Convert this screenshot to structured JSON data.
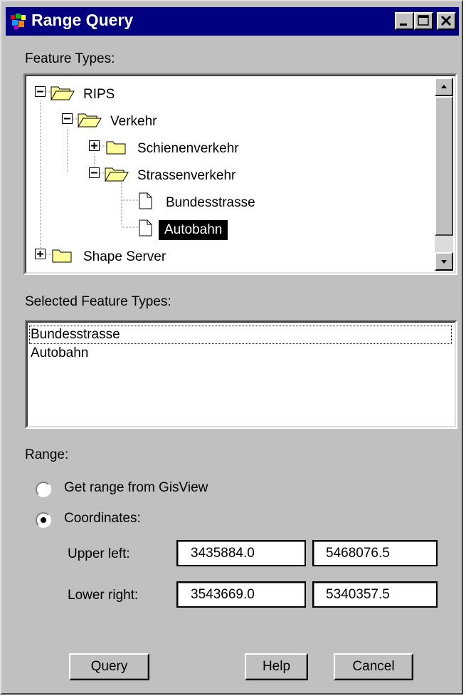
{
  "window": {
    "title": "Range Query",
    "controls": [
      "minimize",
      "maximize",
      "close"
    ]
  },
  "feature_types": {
    "label": "Feature Types:",
    "tree": [
      {
        "label": "RIPS",
        "icon": "folder-open-icon",
        "expander": "minus",
        "level": 0
      },
      {
        "label": "Verkehr",
        "icon": "folder-open-icon",
        "expander": "minus",
        "level": 1
      },
      {
        "label": "Schienenverkehr",
        "icon": "folder-closed-icon",
        "expander": "plus",
        "level": 2
      },
      {
        "label": "Strassenverkehr",
        "icon": "folder-open-icon",
        "expander": "minus",
        "level": 2
      },
      {
        "label": "Bundesstrasse",
        "icon": "document-icon",
        "expander": "none",
        "level": 3
      },
      {
        "label": "Autobahn",
        "icon": "document-icon",
        "expander": "none",
        "level": 3,
        "selected": true
      },
      {
        "label": "Shape Server",
        "icon": "folder-closed-icon",
        "expander": "plus",
        "level": 0
      }
    ]
  },
  "selected_feature_types": {
    "label": "Selected Feature Types:",
    "items": [
      "Bundesstrasse",
      "Autobahn"
    ]
  },
  "range": {
    "label": "Range:",
    "option_gisview": "Get range from GisView",
    "option_coordinates": "Coordinates:",
    "selected": "coordinates",
    "upper_left_label": "Upper left:",
    "upper_left_x": "3435884.0",
    "upper_left_y": "5468076.5",
    "lower_right_label": "Lower right:",
    "lower_right_x": "3543669.0",
    "lower_right_y": "5340357.5"
  },
  "buttons": {
    "query": "Query",
    "help": "Help",
    "cancel": "Cancel"
  },
  "colors": {
    "titlebar": "#000080",
    "face": "#c0c0c0",
    "selection": "#000000",
    "folder": "#ffff99"
  }
}
